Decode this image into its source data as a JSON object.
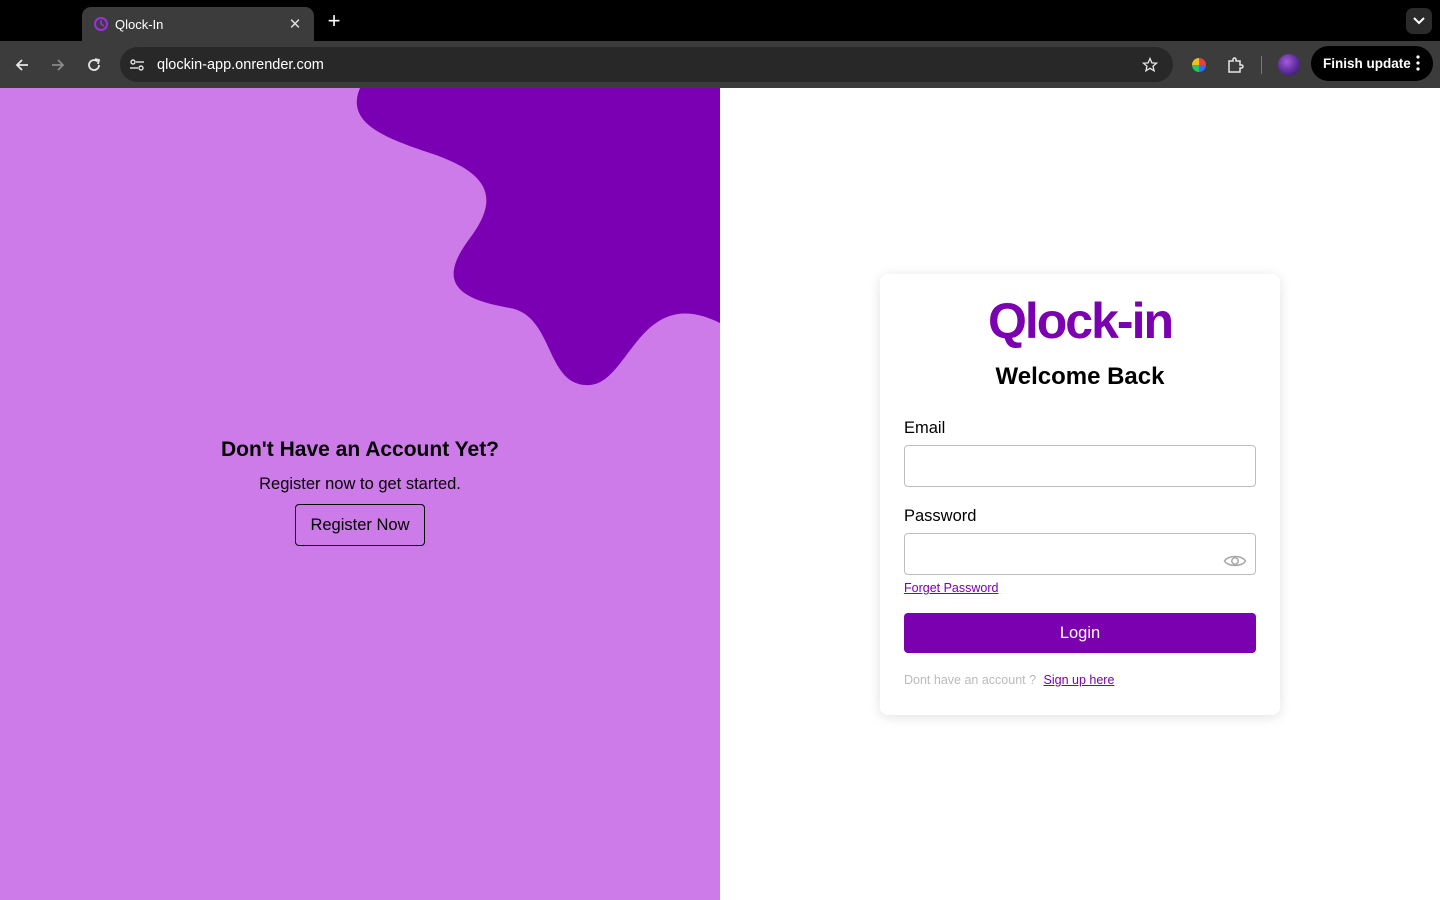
{
  "browser": {
    "tab": {
      "title": "Qlock-In",
      "favicon": "qlock-favicon-icon"
    },
    "url": "qlockin-app.onrender.com",
    "finish_update_label": "Finish update"
  },
  "left_panel": {
    "heading": "Don't Have an Account Yet?",
    "subtext": "Register now to get started.",
    "register_button": "Register Now"
  },
  "login_card": {
    "logo": "Qlock-in",
    "title": "Welcome Back",
    "email_label": "Email",
    "email_value": "",
    "password_label": "Password",
    "password_value": "",
    "forgot_password": "Forget Password",
    "login_button": "Login",
    "signup_prompt": "Dont have an account ?",
    "signup_link": "Sign up here"
  },
  "colors": {
    "brand_purple": "#7a00b0",
    "panel_light_purple": "#cd7be8",
    "blob_purple": "#7b00b4"
  }
}
